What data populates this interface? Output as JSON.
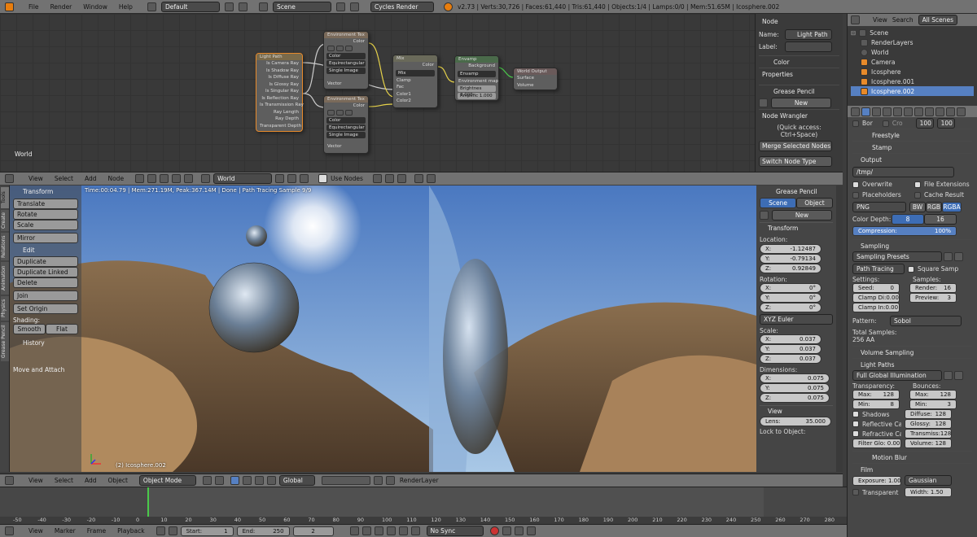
{
  "topbar": {
    "menus": [
      "File",
      "Render",
      "Window",
      "Help"
    ],
    "layout": "Default",
    "scene": "Scene",
    "engine": "Cycles Render",
    "stats": "v2.73 | Verts:30,726 | Faces:61,440 | Tris:61,440 | Objects:1/4 | Lamps:0/0 | Mem:51.65M | Icosphere.002"
  },
  "node_editor": {
    "world_label": "World",
    "nodes": {
      "lightpath": {
        "title": "Light Path",
        "outputs": [
          "Is Camera Ray",
          "Is Shadow Ray",
          "Is Diffuse Ray",
          "Is Glossy Ray",
          "Is Singular Ray",
          "Is Reflection Ray",
          "Is Transmission Ray",
          "Ray Length",
          "Ray Depth",
          "Transparent Depth"
        ]
      },
      "env1": {
        "title": "Environment Tex",
        "out": "Color",
        "d1": "Color",
        "d2": "Equirectangular",
        "d3": "Single Image",
        "vec": "Vector"
      },
      "env2": {
        "title": "Environment Tex",
        "out": "Color",
        "d1": "Color",
        "d2": "Equirectangular",
        "d3": "Single Image",
        "vec": "Vector"
      },
      "mix": {
        "title": "Mix",
        "out": "Color",
        "d1": "Mix",
        "clamp": "Clamp",
        "fac": "Fac",
        "c1": "Color1",
        "c2": "Color2"
      },
      "envamp": {
        "title": "Envamp",
        "out": "Background",
        "d1": "Envamp",
        "inlabel": "Environment map",
        "brightness": "Brightnes 0.000",
        "amplify": "Amplific 1.000"
      },
      "worldout": {
        "title": "World Output",
        "surface": "Surface",
        "volume": "Volume"
      }
    },
    "header": {
      "menus": [
        "View",
        "Select",
        "Add",
        "Node"
      ],
      "world": "World",
      "use_nodes": "Use Nodes"
    }
  },
  "node_sidebar": {
    "node_header": "Node",
    "name_label": "Name:",
    "name_value": "Light Path",
    "label_label": "Label:",
    "color": "Color",
    "properties": "Properties",
    "grease_pencil": "Grease Pencil",
    "new": "New",
    "node_wrangler": "Node Wrangler",
    "quick_access": "(Quick access: Ctrl+Space)",
    "merge": "Merge Selected Nodes",
    "switch": "Switch Node Type"
  },
  "tool_shelf": {
    "tabs": [
      "Tools",
      "Create",
      "Relations",
      "Animation",
      "Physics",
      "Grease Pencil"
    ],
    "transform": "Transform",
    "translate": "Translate",
    "rotate": "Rotate",
    "scale": "Scale",
    "mirror": "Mirror",
    "edit": "Edit",
    "duplicate": "Duplicate",
    "duplicate_linked": "Duplicate Linked",
    "delete": "Delete",
    "join": "Join",
    "set_origin": "Set Origin",
    "shading": "Shading:",
    "smooth": "Smooth",
    "flat": "Flat",
    "history": "History",
    "move_attach": "Move and Attach"
  },
  "viewport": {
    "status": "Time:00:04.79 | Mem:271.19M, Peak:367.14M | Done | Path Tracing Sample 9/9",
    "object_label": "(2) Icosphere.002",
    "header": {
      "menus": [
        "View",
        "Select",
        "Add",
        "Object"
      ],
      "mode": "Object Mode",
      "orientation": "Global",
      "layer": "RenderLayer"
    }
  },
  "n_panel": {
    "grease_pencil": "Grease Pencil",
    "scene": "Scene",
    "object": "Object",
    "new": "New",
    "transform": "Transform",
    "location": "Location:",
    "loc": [
      {
        "a": "X:",
        "v": "-1.12487"
      },
      {
        "a": "Y:",
        "v": "-0.79134"
      },
      {
        "a": "Z:",
        "v": "0.92849"
      }
    ],
    "rotation": "Rotation:",
    "rot": [
      {
        "a": "X:",
        "v": "0°"
      },
      {
        "a": "Y:",
        "v": "0°"
      },
      {
        "a": "Z:",
        "v": "0°"
      }
    ],
    "euler": "XYZ Euler",
    "scale": "Scale:",
    "scl": [
      {
        "a": "X:",
        "v": "0.037"
      },
      {
        "a": "Y:",
        "v": "0.037"
      },
      {
        "a": "Z:",
        "v": "0.037"
      }
    ],
    "dimensions": "Dimensions:",
    "dim": [
      {
        "a": "X:",
        "v": "0.075"
      },
      {
        "a": "Y:",
        "v": "0.075"
      },
      {
        "a": "Z:",
        "v": "0.075"
      }
    ],
    "view": "View",
    "lens": "Lens:",
    "lens_v": "35.000",
    "lock": "Lock to Object:"
  },
  "outliner": {
    "menus": [
      "View",
      "Search",
      "All Scenes"
    ],
    "items": [
      "Scene",
      "RenderLayers",
      "World",
      "Camera",
      "Icosphere",
      "Icosphere.001",
      "Icosphere.002"
    ]
  },
  "properties": {
    "border": "Bor",
    "crop": "Cro",
    "res": [
      "100",
      "100"
    ],
    "freestyle": "Freestyle",
    "stamp": "Stamp",
    "output": "Output",
    "path": "/tmp/",
    "overwrite": "Overwrite",
    "file_ext": "File Extensions",
    "placeholders": "Placeholders",
    "cache": "Cache Result",
    "format": "PNG",
    "bw": "BW",
    "rgb": "RGB",
    "rgba": "RGBA",
    "color_depth": "Color Depth:",
    "d8": "8",
    "d16": "16",
    "compression": "Compression:",
    "compression_v": "100%",
    "sampling": "Sampling",
    "presets": "Sampling Presets",
    "method": "Path Tracing",
    "square": "Square Samp",
    "settings": "Settings:",
    "samples": "Samples:",
    "seed": "Seed:",
    "seed_v": "0",
    "render": "Render:",
    "render_v": "16",
    "clamp_di": "Clamp Di:",
    "clamp_di_v": "0.00",
    "preview": "Preview:",
    "preview_v": "3",
    "clamp_in": "Clamp In:",
    "clamp_in_v": "0.00",
    "pattern": "Pattern:",
    "pattern_v": "Sobol",
    "total": "Total Samples:",
    "total_v": "256 AA",
    "volume_sampling": "Volume Sampling",
    "light_paths": "Light Paths",
    "full_gi": "Full Global Illumination",
    "transparency": "Transparency:",
    "bounces": "Bounces:",
    "t_max": "Max:",
    "t_max_v": "128",
    "b_max": "Max:",
    "b_max_v": "128",
    "t_min": "Min:",
    "t_min_v": "8",
    "b_min": "Min:",
    "b_min_v": "3",
    "shadows": "Shadows",
    "diffuse": "Diffuse:",
    "diffuse_v": "128",
    "reflective": "Reflective Ca",
    "glossy": "Glossy:",
    "glossy_v": "128",
    "refractive": "Refractive Ca",
    "transmiss": "Transmiss:",
    "transmiss_v": "128",
    "volume": "Volume:",
    "volume_v": "128",
    "filter_glo": "Filter Glo: 0.00",
    "motion_blur": "Motion Blur",
    "film": "Film",
    "exposure": "Exposure: 1.00",
    "gaussian": "Gaussian",
    "transparent": "Transparent",
    "width": "Width: 1.50"
  },
  "timeline": {
    "ticks": [
      "-50",
      "-40",
      "-30",
      "-20",
      "-10",
      "0",
      "10",
      "20",
      "30",
      "40",
      "50",
      "60",
      "70",
      "80",
      "90",
      "100",
      "110",
      "120",
      "130",
      "140",
      "150",
      "160",
      "170",
      "180",
      "190",
      "200",
      "210",
      "220",
      "230",
      "240",
      "250",
      "260",
      "270",
      "280"
    ],
    "current_frame": 2,
    "menus": [
      "View",
      "Marker",
      "Frame",
      "Playback"
    ],
    "start": "Start:",
    "start_v": "1",
    "end": "End:",
    "end_v": "250",
    "frame": "2",
    "sync": "No Sync"
  }
}
